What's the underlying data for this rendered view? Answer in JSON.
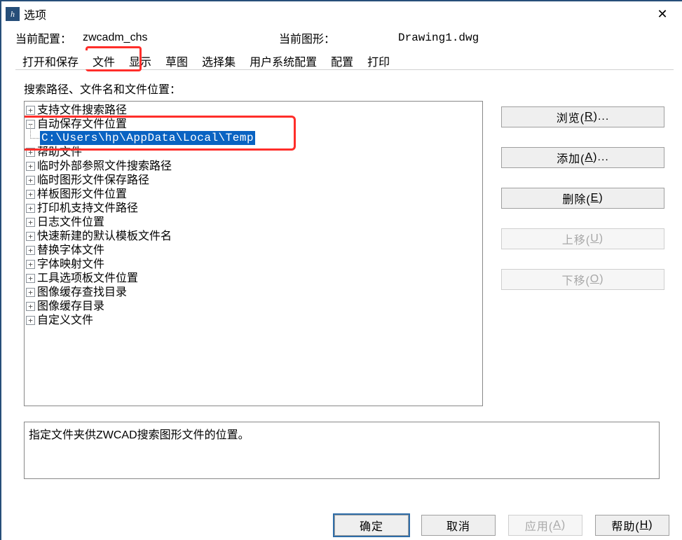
{
  "window": {
    "title": "选项",
    "close_glyph": "✕",
    "app_icon_text": "h"
  },
  "info": {
    "config_label": "当前配置：",
    "config_value": "zwcadm_chs",
    "drawing_label": "当前图形：",
    "drawing_value": "Drawing1.dwg"
  },
  "tabs": [
    "打开和保存",
    "文件",
    "显示",
    "草图",
    "选择集",
    "用户系统配置",
    "配置",
    "打印"
  ],
  "active_tab_index": 1,
  "section_label": "搜索路径、文件名和文件位置：",
  "tree": [
    {
      "label": "支持文件搜索路径",
      "exp": "+"
    },
    {
      "label": "自动保存文件位置",
      "exp": "−",
      "children": [
        {
          "label": "C:\\Users\\hp\\AppData\\Local\\Temp",
          "selected": true
        }
      ]
    },
    {
      "label": "帮助文件",
      "exp": "+"
    },
    {
      "label": "临时外部参照文件搜索路径",
      "exp": "+"
    },
    {
      "label": "临时图形文件保存路径",
      "exp": "+"
    },
    {
      "label": "样板图形文件位置",
      "exp": "+"
    },
    {
      "label": "打印机支持文件路径",
      "exp": "+"
    },
    {
      "label": "日志文件位置",
      "exp": "+"
    },
    {
      "label": "快速新建的默认模板文件名",
      "exp": "+"
    },
    {
      "label": "替换字体文件",
      "exp": "+"
    },
    {
      "label": "字体映射文件",
      "exp": "+"
    },
    {
      "label": "工具选项板文件位置",
      "exp": "+"
    },
    {
      "label": "图像缓存查找目录",
      "exp": "+"
    },
    {
      "label": "图像缓存目录",
      "exp": "+"
    },
    {
      "label": "自定义文件",
      "exp": "+"
    }
  ],
  "side_buttons": {
    "browse": {
      "text": "浏览(",
      "accel": "R",
      "suffix": ")...",
      "enabled": true
    },
    "add": {
      "text": "添加(",
      "accel": "A",
      "suffix": ")...",
      "enabled": true
    },
    "delete": {
      "text": "删除(",
      "accel": "E",
      "suffix": ")",
      "enabled": true
    },
    "moveup": {
      "text": "上移(",
      "accel": "U",
      "suffix": ")",
      "enabled": false
    },
    "movedown": {
      "text": "下移(",
      "accel": "O",
      "suffix": ")",
      "enabled": false
    }
  },
  "description": "指定文件夹供ZWCAD搜索图形文件的位置。",
  "footer": {
    "ok": {
      "text": "确定",
      "accel": "",
      "suffix": "",
      "enabled": true,
      "primary": true
    },
    "cancel": {
      "text": "取消",
      "accel": "",
      "suffix": "",
      "enabled": true
    },
    "apply": {
      "text": "应用(",
      "accel": "A",
      "suffix": ")",
      "enabled": false
    },
    "help": {
      "text": "帮助(",
      "accel": "H",
      "suffix": ")",
      "enabled": true
    }
  }
}
